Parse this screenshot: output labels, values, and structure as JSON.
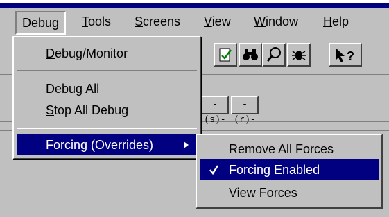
{
  "menubar": {
    "items": [
      {
        "label": "Debug",
        "open": true
      },
      {
        "label": "Tools"
      },
      {
        "label": "Screens"
      },
      {
        "label": "View"
      },
      {
        "label": "Window"
      },
      {
        "label": "Help"
      }
    ]
  },
  "toolbar": {
    "icons": [
      "document-check-icon",
      "binoculars-icon",
      "magnifier-icon",
      "bug-icon",
      "help-pointer-icon"
    ],
    "small_buttons": [
      "-(s)-",
      "-(r)-"
    ]
  },
  "debug_menu": {
    "items": [
      {
        "label": "Debug/Monitor"
      },
      {
        "label": "Debug All"
      },
      {
        "label": "Stop All Debug"
      },
      {
        "label": "Forcing (Overrides)",
        "has_submenu": true,
        "highlighted": true
      }
    ]
  },
  "forcing_submenu": {
    "items": [
      {
        "label": "Remove All Forces"
      },
      {
        "label": "Forcing Enabled",
        "checked": true,
        "highlighted": true
      },
      {
        "label": "View Forces"
      }
    ]
  },
  "colors": {
    "highlight": "#000080",
    "face": "#c0c0c0"
  }
}
